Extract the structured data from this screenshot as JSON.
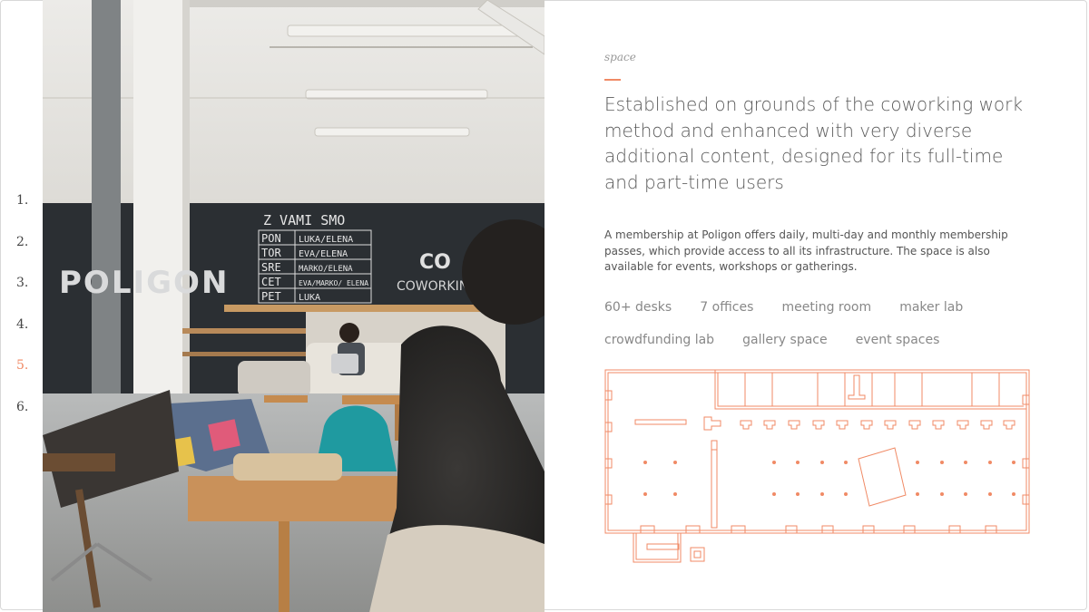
{
  "pagination": {
    "items": [
      {
        "label": "1."
      },
      {
        "label": "2."
      },
      {
        "label": "3."
      },
      {
        "label": "4."
      },
      {
        "label": "5."
      },
      {
        "label": "6."
      }
    ],
    "active_index": 4
  },
  "photo": {
    "chalkboard_lines": [
      "Z VAMI SMO",
      "PON",
      "LUKA/ELENA",
      "TOR",
      "EVA/ELENA",
      "SRE",
      "MARKO/ELENA",
      "CET",
      "EVA/MARKO/ ELENA",
      "PET",
      "LUKA"
    ],
    "wall_logo": "POLIGON",
    "sign_co": "CO",
    "sign_working": "COWORKING"
  },
  "section": {
    "eyebrow": "space",
    "headline": "Established on grounds of the coworking work method and enhanced with very diverse additional content, designed for its full-time and part-time users",
    "description": "A membership at Poligon offers daily, multi-day and monthly membership passes, which provide access to all its infrastructure. The space is also available for events, workshops or gatherings.",
    "tags": [
      "60+ desks",
      "7 offices",
      "meeting room",
      "maker lab",
      "crowdfunding lab",
      "gallery space",
      "event spaces"
    ]
  },
  "colors": {
    "accent": "#f08a65",
    "text": "#5a5a5a",
    "muted": "#888888",
    "chalkboard": "#2b2f33"
  }
}
